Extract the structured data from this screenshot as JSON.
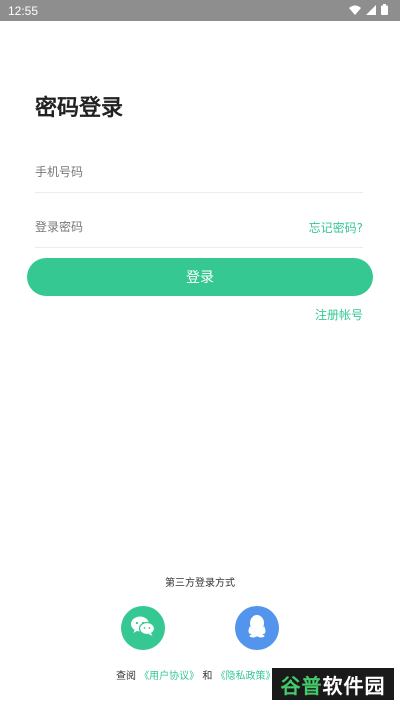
{
  "status_bar": {
    "time": "12:55"
  },
  "title": "密码登录",
  "phone": {
    "placeholder": "手机号码",
    "value": ""
  },
  "password": {
    "placeholder": "登录密码",
    "value": ""
  },
  "forgot_label": "忘记密码?",
  "login_label": "登录",
  "register_label": "注册帐号",
  "third_party": {
    "title": "第三方登录方式",
    "icons": [
      "wechat-icon",
      "qq-icon"
    ]
  },
  "agreement": {
    "prefix": "查阅",
    "user_link": "《用户协议》",
    "and": "和",
    "privacy_link": "《隐私政策》"
  },
  "watermark": {
    "part1": "谷普",
    "part2": "软件园"
  },
  "colors": {
    "accent": "#35c892",
    "qq": "#5394ec",
    "status_bar": "#8e8e8e"
  }
}
